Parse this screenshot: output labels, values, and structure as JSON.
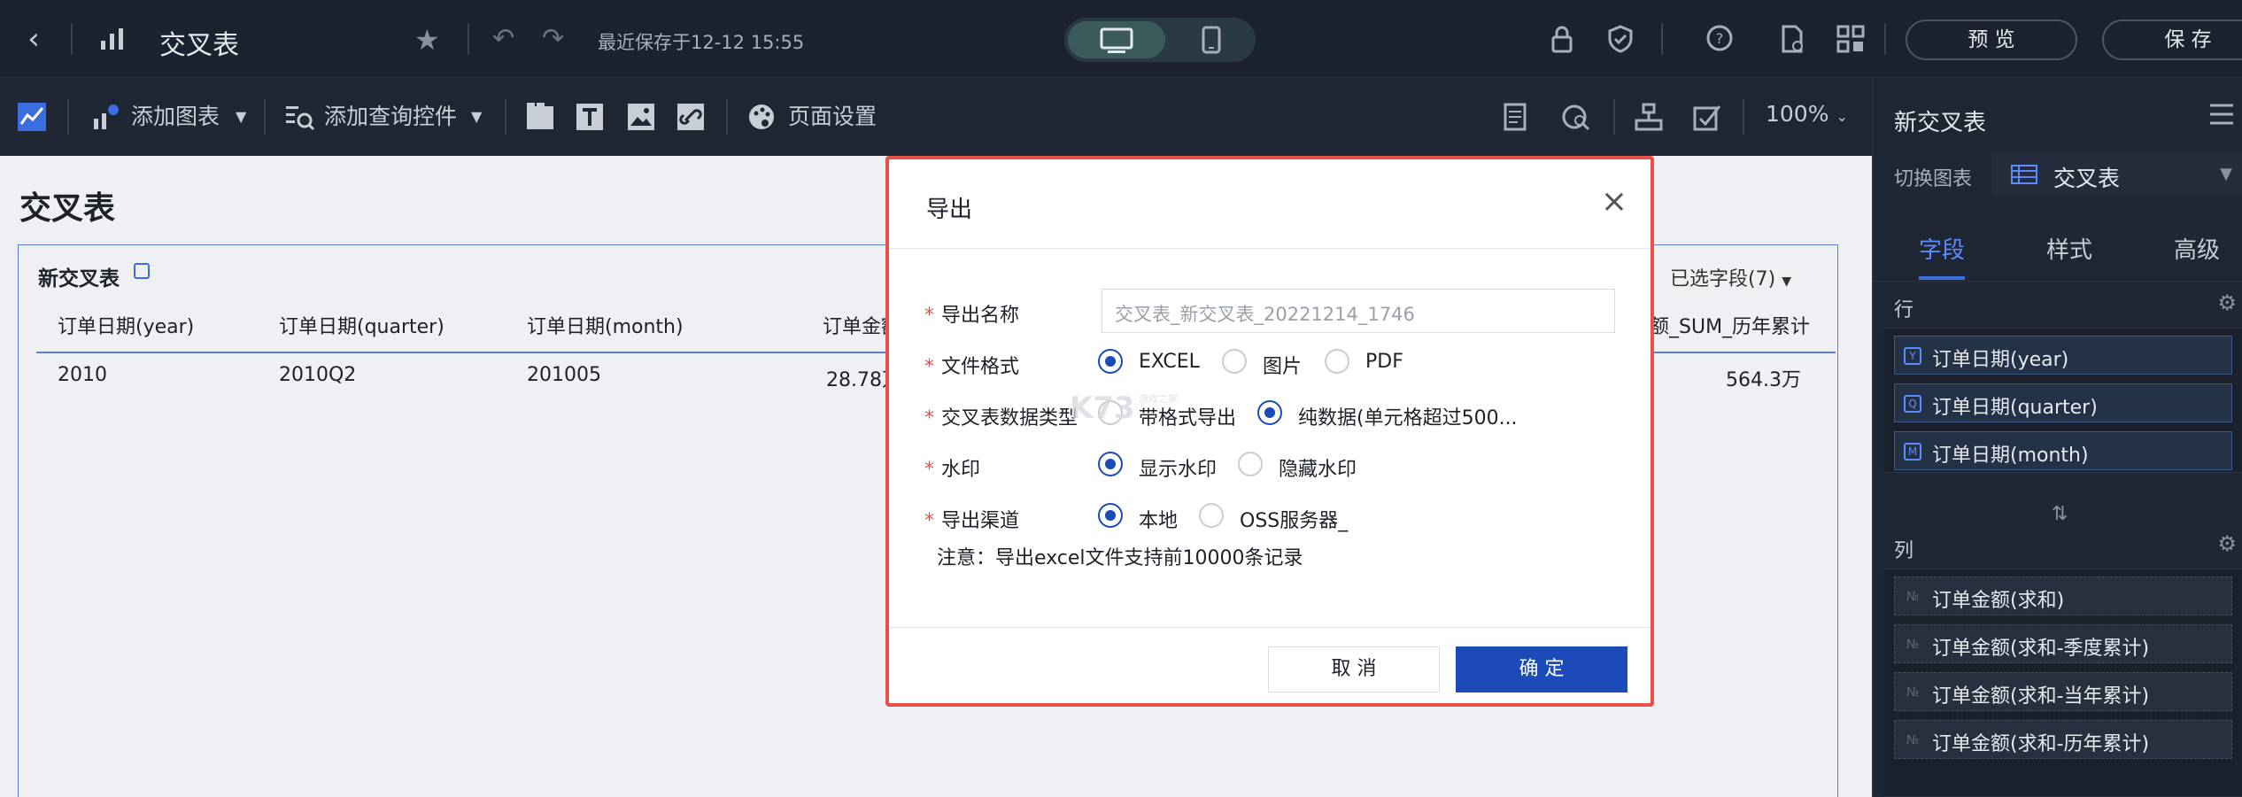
{
  "topbar": {
    "title": "交叉表",
    "saved_text": "最近保存于12-12 15:55",
    "preview_label": "预 览",
    "save_label": "保 存"
  },
  "toolbar": {
    "add_chart": "添加图表",
    "add_query_control": "添加查询控件",
    "page_settings": "页面设置",
    "zoom": "100%"
  },
  "canvas": {
    "page_title": "交叉表",
    "card_title": "新交叉表",
    "selected_fields": "已选字段(7)",
    "columns": [
      "订单日期(year)",
      "订单日期(quarter)",
      "订单日期(month)",
      "订单金额",
      "额_SUM_历年累计"
    ],
    "row": [
      "2010",
      "2010Q2",
      "201005",
      "28.78万",
      "564.3万"
    ]
  },
  "right_panel": {
    "title": "新交叉表",
    "switch_chart_label": "切换图表",
    "switch_chart_value": "交叉表",
    "tabs": [
      {
        "label": "字段",
        "active": true
      },
      {
        "label": "样式",
        "active": false
      },
      {
        "label": "高级",
        "active": false
      }
    ],
    "rows_label": "行",
    "row_fields": [
      {
        "icon": "Y",
        "label": "订单日期(year)"
      },
      {
        "icon": "Q",
        "label": "订单日期(quarter)"
      },
      {
        "icon": "M",
        "label": "订单日期(month)"
      }
    ],
    "cols_label": "列",
    "col_fields": [
      {
        "icon": "№",
        "label": "订单金额(求和)"
      },
      {
        "icon": "№",
        "label": "订单金额(求和-季度累计)"
      },
      {
        "icon": "№",
        "label": "订单金额(求和-当年累计)"
      },
      {
        "icon": "№",
        "label": "订单金额(求和-历年累计)"
      }
    ]
  },
  "dialog": {
    "title": "导出",
    "name_label": "导出名称",
    "name_placeholder": "交叉表_新交叉表_20221214_1746",
    "format_label": "文件格式",
    "format_options": [
      {
        "label": "EXCEL",
        "selected": true
      },
      {
        "label": "图片",
        "selected": false
      },
      {
        "label": "PDF",
        "selected": false
      }
    ],
    "data_type_label": "交叉表数据类型",
    "data_type_options": [
      {
        "label": "带格式导出",
        "selected": false
      },
      {
        "label": "纯数据(单元格超过500...",
        "selected": true
      }
    ],
    "watermark_label": "水印",
    "watermark_options": [
      {
        "label": "显示水印",
        "selected": true
      },
      {
        "label": "隐藏水印",
        "selected": false
      }
    ],
    "channel_label": "导出渠道",
    "channel_options": [
      {
        "label": "本地",
        "selected": true
      },
      {
        "label": "OSS服务器_",
        "selected": false
      }
    ],
    "note": "注意：导出excel文件支持前10000条记录",
    "cancel_label": "取 消",
    "ok_label": "确 定",
    "watermark_text": "K73",
    "watermark_sub": "游戏之家"
  },
  "colors": {
    "accent": "#1a4bb8",
    "highlight_border": "#e8504a",
    "dark_bg": "#1c2230"
  }
}
